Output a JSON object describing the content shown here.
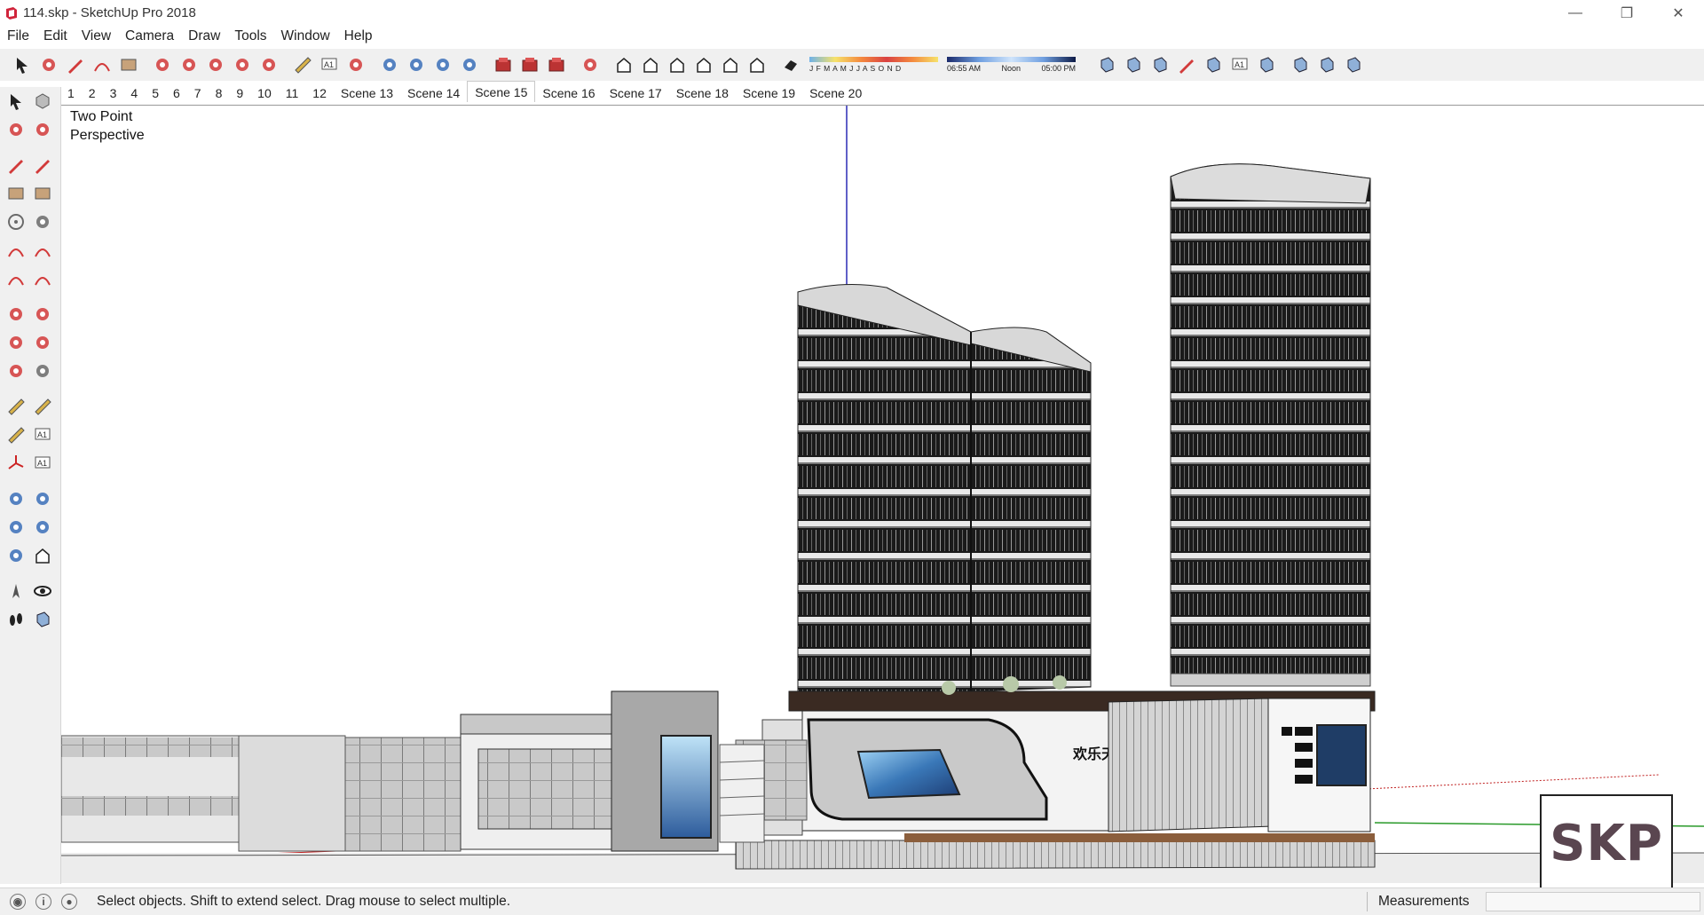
{
  "window": {
    "title": "114.skp - SketchUp Pro 2018",
    "controls": [
      "minimize-icon",
      "restore-icon",
      "close-icon"
    ]
  },
  "menu": [
    "File",
    "Edit",
    "View",
    "Camera",
    "Draw",
    "Tools",
    "Window",
    "Help"
  ],
  "toolbar": {
    "groups": [
      [
        "select-icon",
        "eraser-icon",
        "pencil-icon",
        "arc-icon",
        "rectangle-icon"
      ],
      [
        "push-pull-icon",
        "follow-me-icon",
        "move-icon",
        "rotate-icon",
        "scale-icon"
      ],
      [
        "tape-measure-icon",
        "text-icon",
        "paint-bucket-icon"
      ],
      [
        "orbit-icon",
        "pan-icon",
        "zoom-icon",
        "zoom-extents-icon"
      ],
      [
        "warehouse-icon",
        "extension-warehouse-icon",
        "layout-icon"
      ],
      [
        "ruby-icon"
      ],
      [
        "iso-view-icon",
        "top-view-icon",
        "front-view-icon",
        "right-view-icon",
        "back-view-icon",
        "left-view-icon"
      ],
      [
        "shadows-icon"
      ]
    ],
    "shadow_months": "J F M A M J J A S O N D",
    "shadow_time_start": "06:55 AM",
    "shadow_time_mid": "Noon",
    "shadow_time_end": "05:00 PM",
    "style_groups": [
      [
        "xray-icon",
        "back-edges-icon",
        "wireframe-icon",
        "hidden-line-icon",
        "shaded-icon",
        "shaded-textures-icon",
        "monochrome-icon"
      ],
      [
        "section-plane-icon",
        "section-cut-icon",
        "section-fill-icon"
      ]
    ]
  },
  "scenes": {
    "tabs": [
      "1",
      "2",
      "3",
      "4",
      "5",
      "6",
      "7",
      "8",
      "9",
      "10",
      "11",
      "12",
      "Scene 13",
      "Scene 14",
      "Scene 15",
      "Scene 16",
      "Scene 17",
      "Scene 18",
      "Scene 19",
      "Scene 20"
    ],
    "active": "Scene 15"
  },
  "left_tools": [
    [
      "select-icon",
      "component-icon"
    ],
    [
      "paint-bucket-icon",
      "eraser-icon"
    ],
    [
      "line-icon",
      "freehand-icon"
    ],
    [
      "rectangle-icon",
      "rotated-rectangle-icon"
    ],
    [
      "circle-icon",
      "polygon-icon"
    ],
    [
      "arc-icon",
      "two-point-arc-icon"
    ],
    [
      "three-point-arc-icon",
      "pie-icon"
    ],
    [
      "move-icon",
      "push-pull-icon"
    ],
    [
      "rotate-icon",
      "follow-me-icon"
    ],
    [
      "scale-icon",
      "offset-icon"
    ],
    [
      "tape-measure-icon",
      "dimension-icon"
    ],
    [
      "protractor-icon",
      "text-icon"
    ],
    [
      "axes-icon",
      "3d-text-icon"
    ],
    [
      "orbit-icon",
      "pan-icon"
    ],
    [
      "zoom-icon",
      "zoom-window-icon"
    ],
    [
      "zoom-extents-icon",
      "previous-view-icon"
    ],
    [
      "position-camera-icon",
      "look-around-icon"
    ],
    [
      "walk-icon",
      "section-plane-icon"
    ]
  ],
  "viewport": {
    "camera_label_line1": "Two Point",
    "camera_label_line2": "Perspective",
    "skp_badge": "SKP",
    "billboard_brand": "欢乐天"
  },
  "status": {
    "message": "Select objects. Shift to extend select. Drag mouse to select multiple.",
    "measurements_label": "Measurements",
    "measurements_value": ""
  }
}
